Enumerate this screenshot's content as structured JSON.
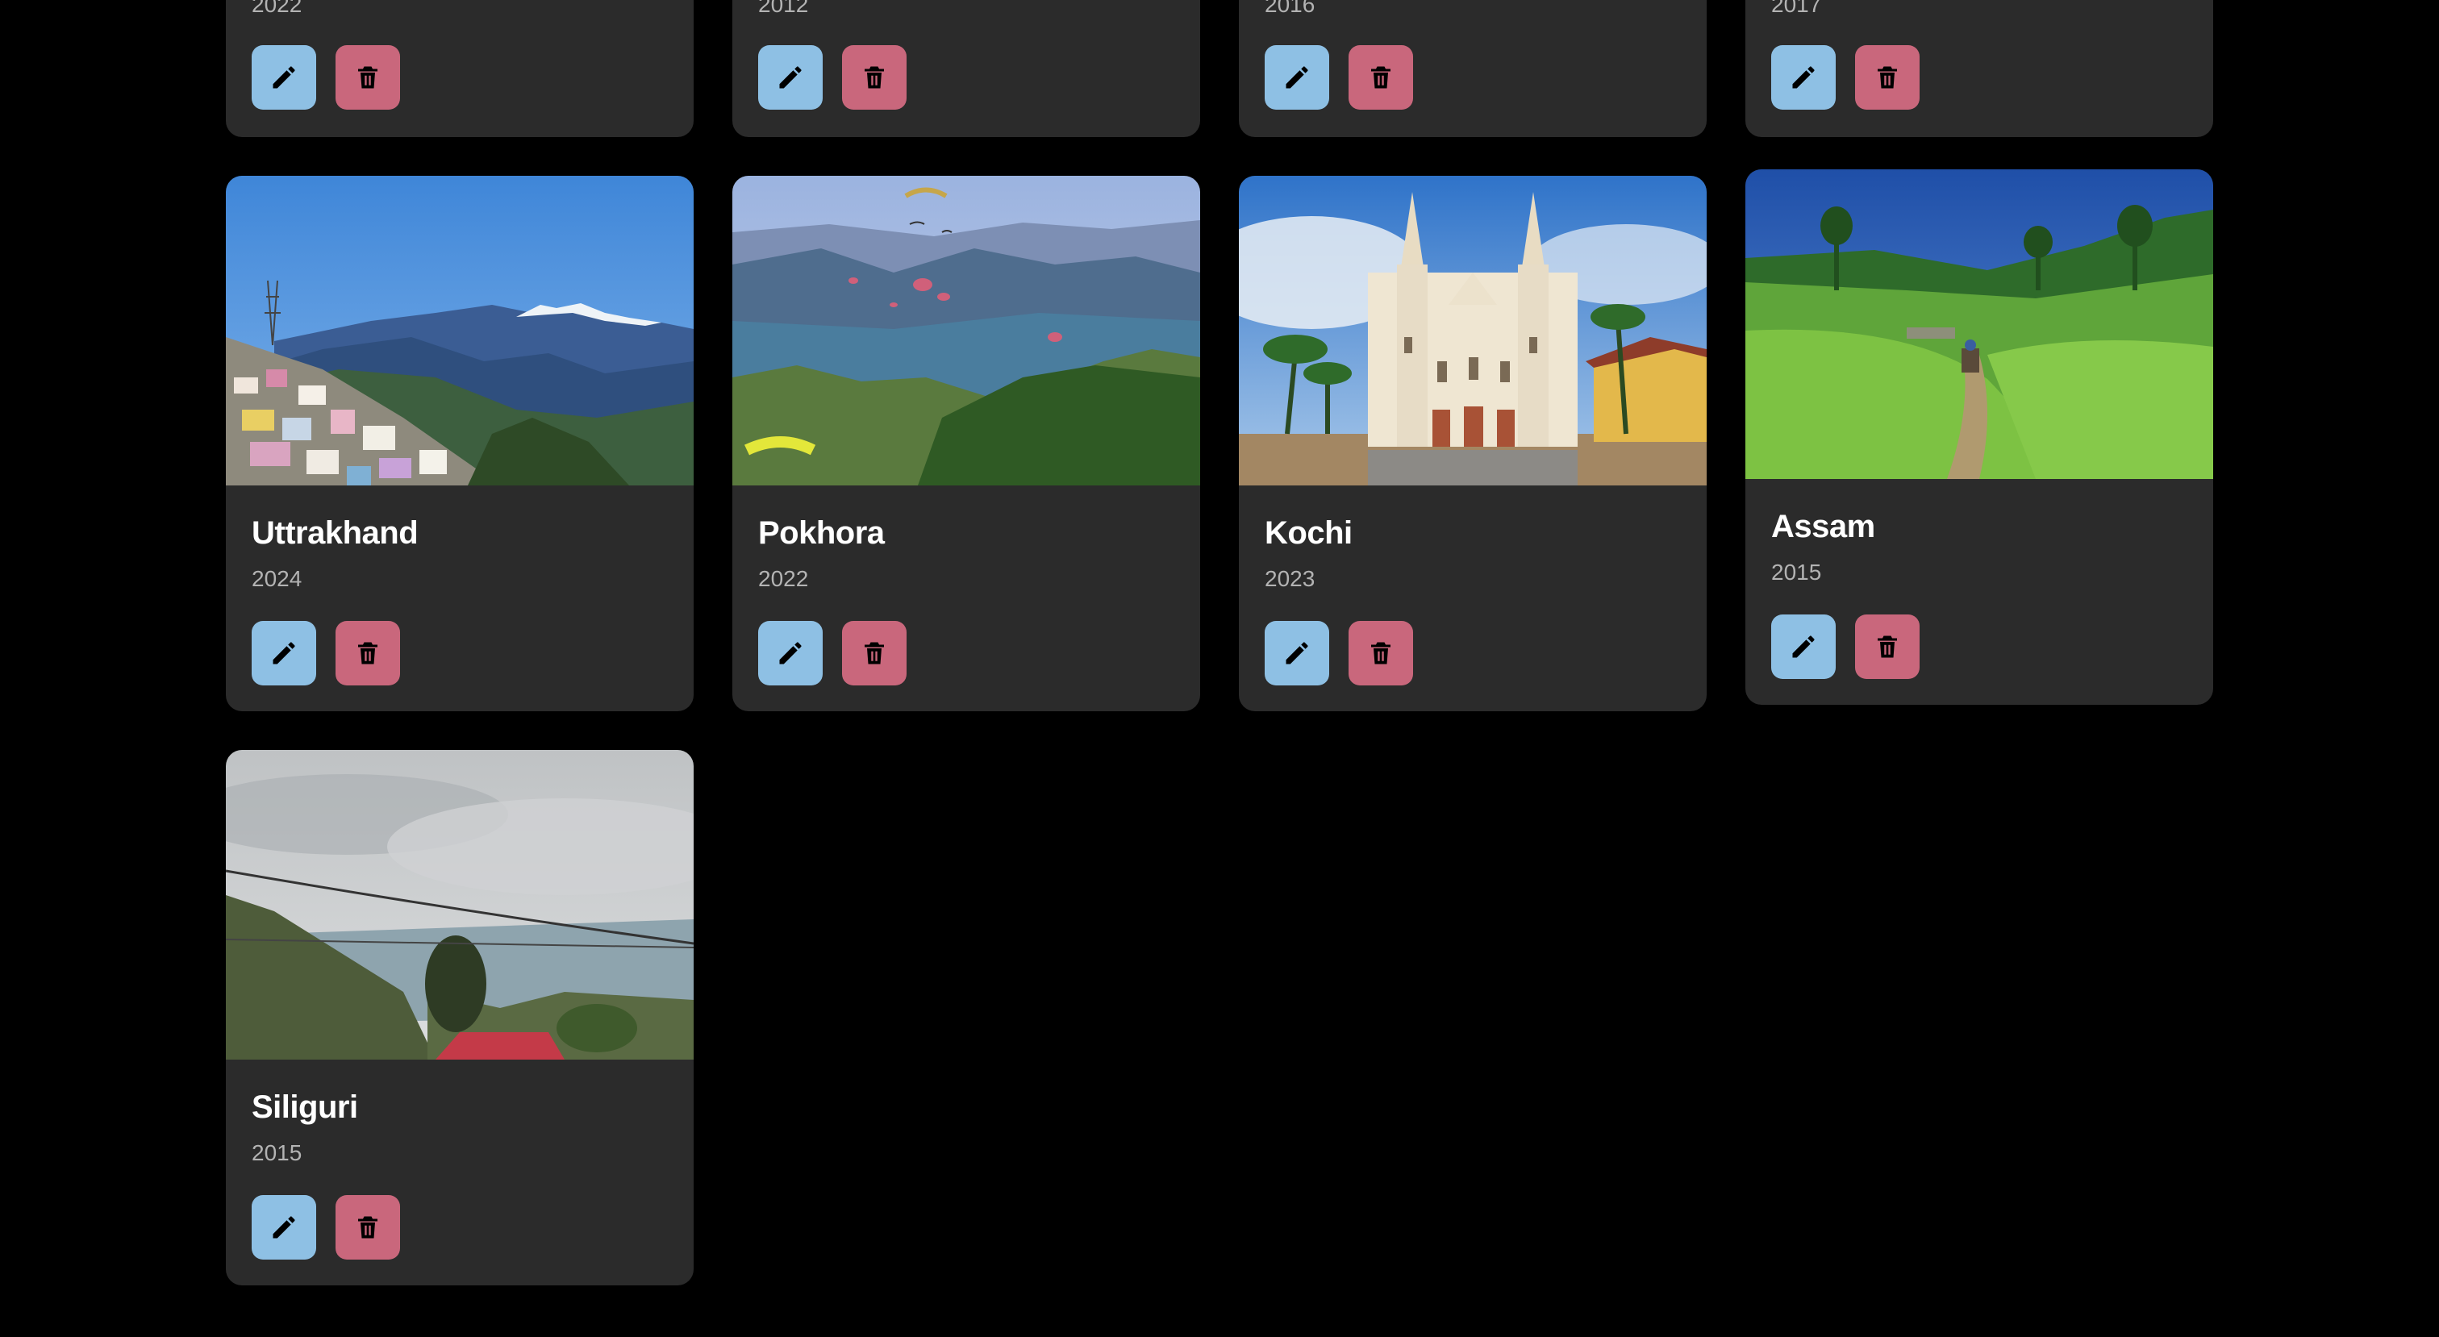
{
  "colors": {
    "background": "#000000",
    "card": "#2b2b2b",
    "edit_button": "#8ec0e4",
    "delete_button": "#c9677c",
    "title_text": "#ffffff",
    "year_text": "#b3b3b3"
  },
  "actions": {
    "edit_icon": "pencil-icon",
    "delete_icon": "trash-icon"
  },
  "top_row": [
    {
      "year": "2022"
    },
    {
      "year": "2012"
    },
    {
      "year": "2016"
    },
    {
      "year": "2017"
    }
  ],
  "cards": [
    {
      "title": "Uttrakhand",
      "year": "2024",
      "photo": "hill-town-snow-mountains"
    },
    {
      "title": "Pokhora",
      "year": "2022",
      "photo": "lake-paragliders"
    },
    {
      "title": "Kochi",
      "year": "2023",
      "photo": "white-basilica"
    },
    {
      "title": "Assam",
      "year": "2015",
      "photo": "tea-garden-path"
    },
    {
      "title": "Siliguri",
      "year": "2015",
      "photo": "cloudy-hills-red-roof"
    }
  ]
}
